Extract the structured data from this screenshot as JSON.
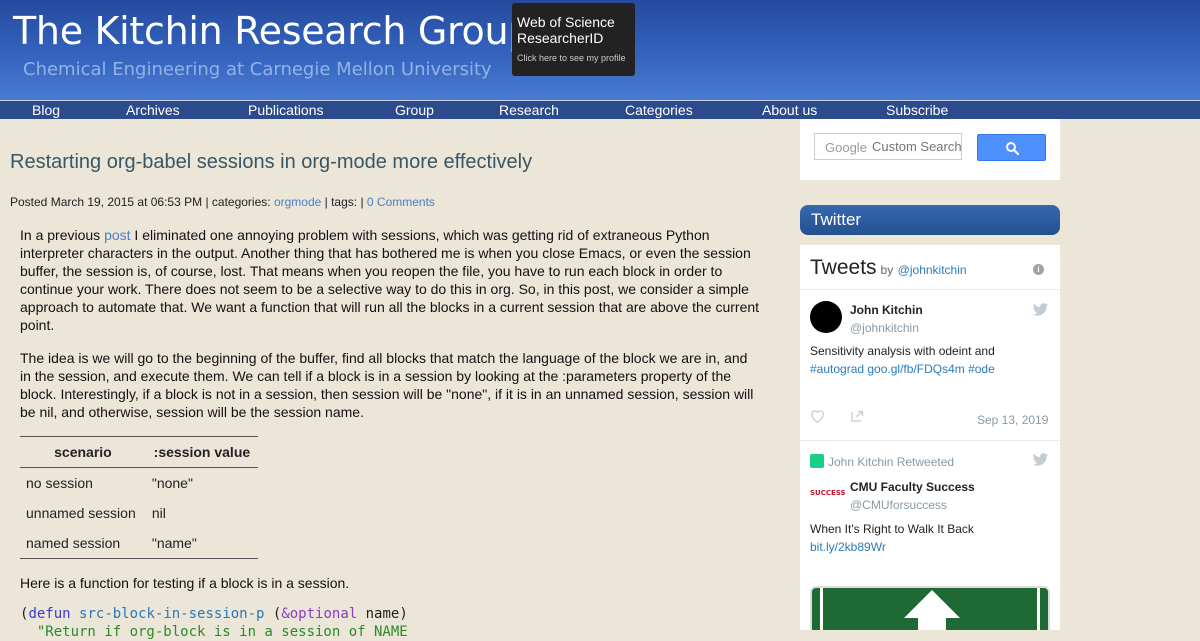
{
  "header": {
    "site_title": "The Kitchin Research Group",
    "site_subtitle": "Chemical Engineering at Carnegie Mellon University",
    "badge": {
      "line1": "Web of Science",
      "line2": "ResearcherID",
      "link": "Click here to see my profile"
    }
  },
  "nav": {
    "items": [
      "Blog",
      "Archives",
      "Publications",
      "Group",
      "Research",
      "Categories",
      "About us",
      "Subscribe"
    ]
  },
  "post": {
    "title": "Restarting org-babel sessions in org-mode more effectively",
    "meta": {
      "posted": "Posted March 19, 2015 at 06:53 PM | categories: ",
      "category": "orgmode",
      "tags": " | tags: | ",
      "comments": "0 Comments"
    },
    "p1_pre": "In a previous ",
    "p1_link": "post",
    "p1_post": " I eliminated one annoying problem with sessions, which was getting rid of extraneous Python interpreter characters in the output. Another thing that has bothered me is when you close Emacs, or even the session buffer, the session is, of course, lost. That means when you reopen the file, you have to run each block in order to continue your work. There does not seem to be a selective way to do this in org. So, in this post, we consider a simple approach to automate that. We want a function that will run all the blocks in a current session that are above the current point.",
    "p2": "The idea is we will go to the beginning of the buffer, find all blocks that match the language of the block we are in, and in the session, and execute them. We can tell if a block is in a session by looking at the :parameters property of the block. Interestingly, if a block is not in a session, then session will be \"none\", if it is in an unnamed session, session will be nil, and otherwise, session will be the session name.",
    "table": {
      "headers": [
        "scenario",
        ":session value"
      ],
      "rows": [
        [
          "no session",
          "\"none\""
        ],
        [
          "unnamed session",
          "nil"
        ],
        [
          "named session",
          "\"name\""
        ]
      ]
    },
    "p3": "Here is a function for testing if a block is in a session.",
    "code": {
      "open": "(",
      "defun": "defun",
      "fn_name": "src-block-in-session-p",
      "paren": " (",
      "optional": "&optional",
      "args": " name)",
      "docstring": "  \"Return if org-block is in a session of NAME"
    }
  },
  "sidebar": {
    "search": {
      "google_label": "Google",
      "placeholder": "Custom Search"
    },
    "twitter_header": "Twitter",
    "timeline": {
      "title": "Tweets",
      "by": "by",
      "handle": "@johnkitchin",
      "tweet1": {
        "name": "John Kitchin",
        "handle": "@johnkitchin",
        "text": "Sensitivity analysis with odeint and",
        "tags": "#autograd goo.gl/fb/FDQs4m #ode",
        "date": "Sep 13, 2019"
      },
      "tweet2": {
        "retweet_label": "John Kitchin Retweeted",
        "avatar_text": "SUCCESS",
        "name": "CMU Faculty Success",
        "handle": "@CMUforsuccess",
        "text": "When It's Right to Walk It Back",
        "link": "bit.ly/2kb89Wr"
      }
    }
  },
  "colors": {
    "page_bg": "#ebe6d8",
    "header_blue": "#3463be",
    "nav_blue": "#2c4b8c",
    "link_blue": "#4b7ec4",
    "twitter_link": "#2b7bb9",
    "search_button": "#4d90fe"
  }
}
